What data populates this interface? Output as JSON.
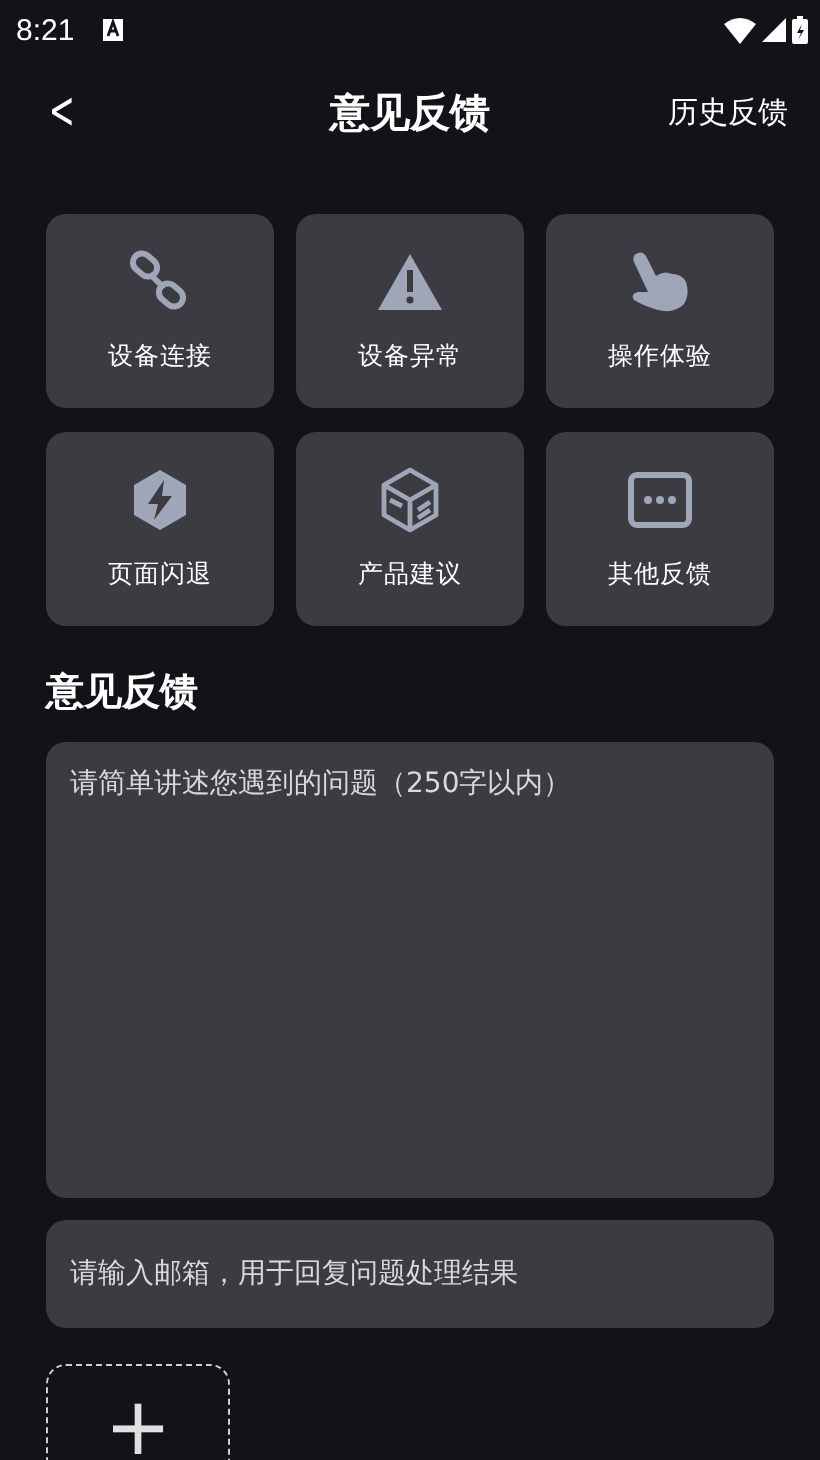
{
  "status_bar": {
    "time": "8:21"
  },
  "header": {
    "back": "<",
    "title": "意见反馈",
    "action": "历史反馈"
  },
  "categories": [
    {
      "label": "设备连接",
      "kind": "link"
    },
    {
      "label": "设备异常",
      "kind": "warning"
    },
    {
      "label": "操作体验",
      "kind": "hand"
    },
    {
      "label": "页面闪退",
      "kind": "bolt"
    },
    {
      "label": "产品建议",
      "kind": "box"
    },
    {
      "label": "其他反馈",
      "kind": "more"
    }
  ],
  "feedback": {
    "title": "意见反馈",
    "placeholder": "请简单讲述您遇到的问题（250字以内）"
  },
  "email": {
    "placeholder": "请输入邮箱，用于回复问题处理结果"
  },
  "upload": {
    "plus": "+"
  }
}
